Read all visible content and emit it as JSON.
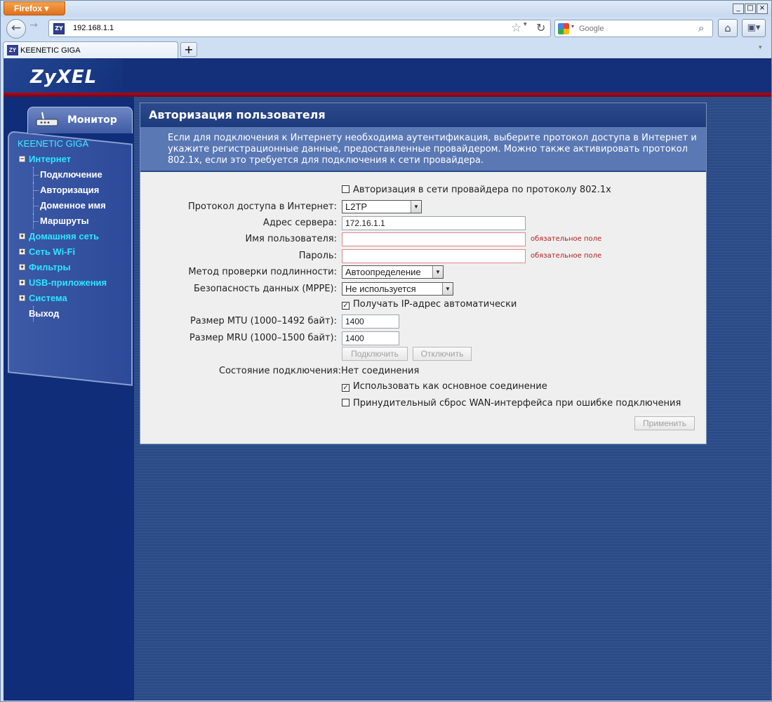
{
  "browser": {
    "menu_button": "Firefox",
    "url": "192.168.1.1",
    "search_placeholder": "Google",
    "tab_title": "KEENETIC GIGA",
    "fav_text": "ZY",
    "new_tab": "+",
    "win_min": "_",
    "win_max": "□",
    "win_close": "×"
  },
  "header": {
    "logo": "ZyXEL"
  },
  "sidebar": {
    "monitor_tab": "Монитор",
    "device": "KEENETIC GIGA",
    "items": [
      {
        "label": "Интернет",
        "sign": "−",
        "subs": [
          "Подключение",
          "Авторизация",
          "Доменное имя",
          "Маршруты"
        ]
      },
      {
        "label": "Домашняя сеть",
        "sign": "+"
      },
      {
        "label": "Сеть Wi-Fi",
        "sign": "+"
      },
      {
        "label": "Фильтры",
        "sign": "+"
      },
      {
        "label": "USB-приложения",
        "sign": "+"
      },
      {
        "label": "Система",
        "sign": "+"
      },
      {
        "label": "Выход"
      }
    ]
  },
  "content": {
    "title": "Авторизация пользователя",
    "description": "Если для подключения к Интернету необходима аутентификация, выберите протокол доступа в Интернет и укажите регистрационные данные, предоставленные провайдером. Можно также активировать протокол 802.1x, если это требуется для подключения к сети провайдера.",
    "auth_8021x": {
      "label": "Авторизация в сети провайдера по протоколу 802.1x",
      "checked": false
    },
    "protocol": {
      "label": "Протокол доступа в Интернет:",
      "value": "L2TP"
    },
    "server": {
      "label": "Адрес сервера:",
      "value": "172.16.1.1"
    },
    "username": {
      "label": "Имя пользователя:",
      "value": "",
      "note": "обязательное поле"
    },
    "password": {
      "label": "Пароль:",
      "value": "",
      "note": "обязательное поле"
    },
    "auth_method": {
      "label": "Метод проверки подлинности:",
      "value": "Автоопределение"
    },
    "security": {
      "label": "Безопасность данных (MPPE):",
      "value": "Не используется"
    },
    "auto_ip": {
      "label": "Получать IP-адрес автоматически",
      "checked": true
    },
    "mtu": {
      "label": "Размер MTU (1000–1492 байт):",
      "value": "1400"
    },
    "mru": {
      "label": "Размер MRU (1000–1500 байт):",
      "value": "1400"
    },
    "connect_button": "Подключить",
    "disconnect_button": "Отключить",
    "status": {
      "label": "Состояние подключения:",
      "value": "Нет соединения"
    },
    "use_main": {
      "label": "Использовать как основное соединение",
      "checked": true
    },
    "force_reset": {
      "label": "Принудительный сброс WAN-интерфейса при ошибке подключения",
      "checked": false
    },
    "apply_button": "Применить"
  }
}
